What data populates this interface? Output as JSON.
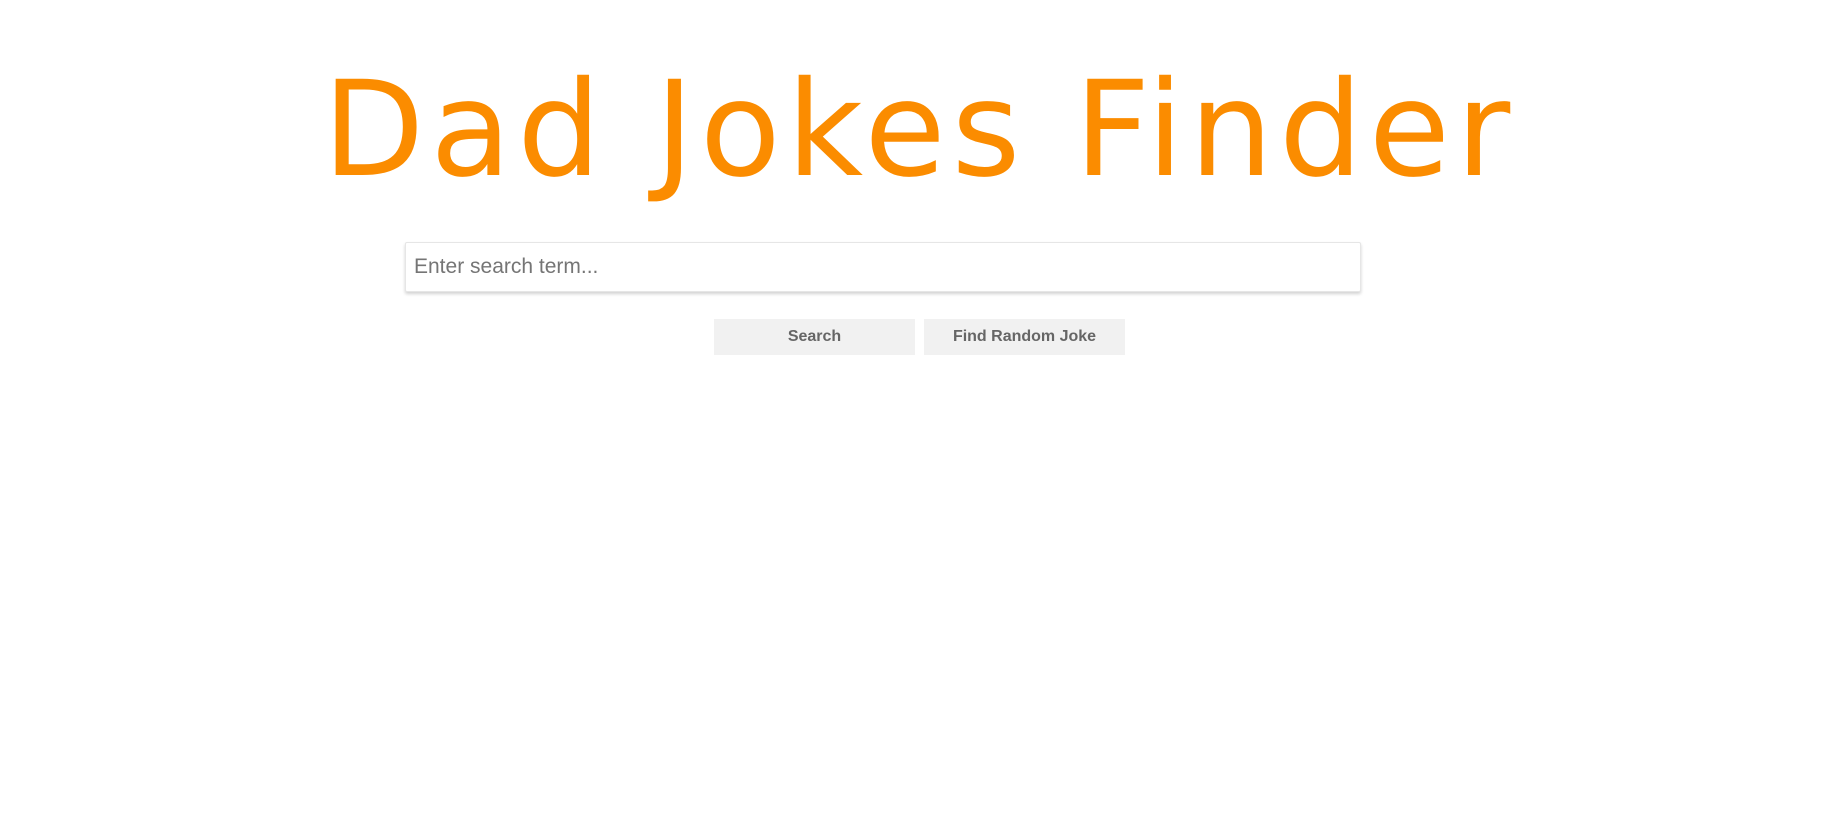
{
  "header": {
    "title": "Dad Jokes Finder"
  },
  "search": {
    "placeholder": "Enter search term...",
    "value": ""
  },
  "buttons": {
    "search_label": "Search",
    "random_label": "Find Random Joke"
  },
  "colors": {
    "accent": "#fb8c00",
    "button_bg": "#f1f1f1",
    "button_text": "#666666"
  }
}
